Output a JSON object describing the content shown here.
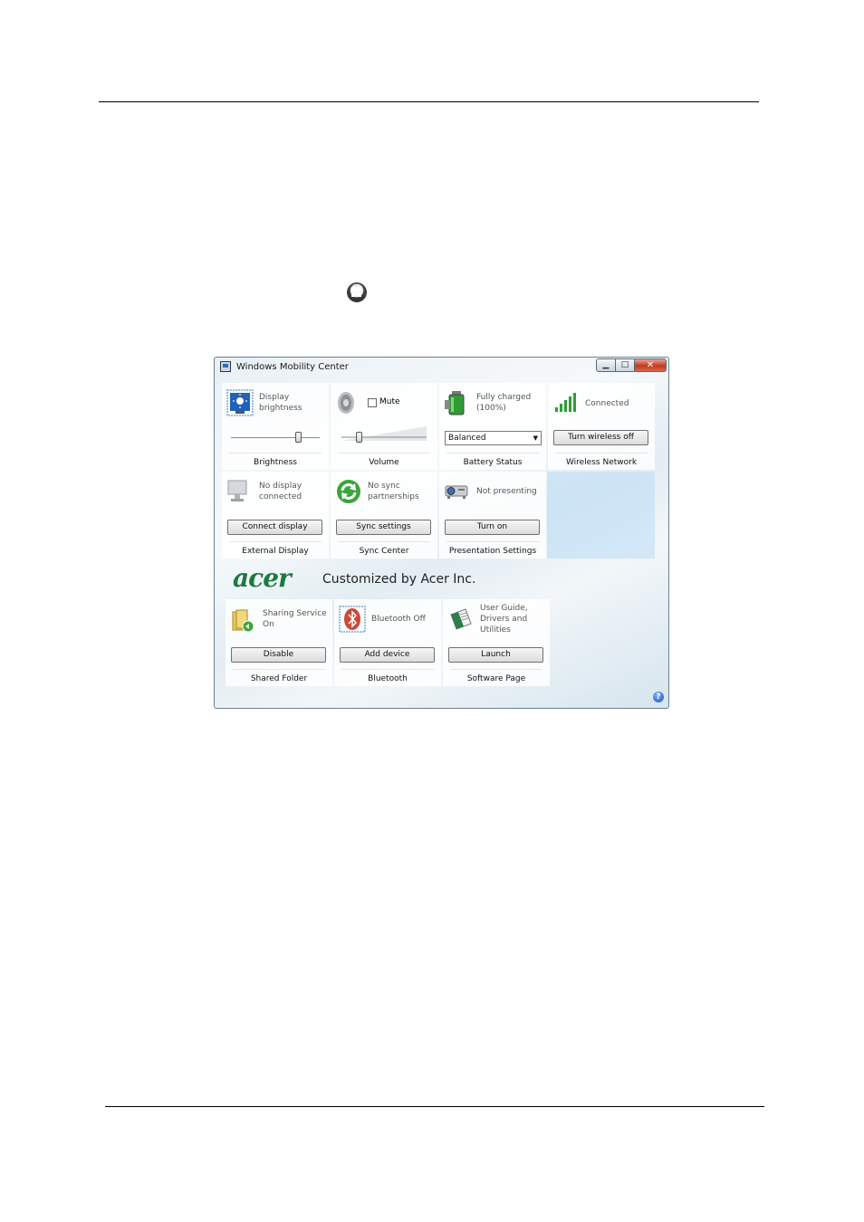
{
  "window": {
    "title": "Windows Mobility Center",
    "help_glyph": "?"
  },
  "tiles": {
    "brightness": {
      "text": "Display brightness",
      "label": "Brightness",
      "level": 0.75
    },
    "volume": {
      "mute_label": "Mute",
      "label": "Volume",
      "level": 0.2
    },
    "battery": {
      "text": "Fully charged (100%)",
      "plan": "Balanced",
      "label": "Battery Status"
    },
    "wireless": {
      "text": "Connected",
      "button": "Turn wireless off",
      "label": "Wireless Network"
    },
    "external_display": {
      "text": "No display connected",
      "button": "Connect display",
      "label": "External Display"
    },
    "sync": {
      "text": "No sync partnerships",
      "button": "Sync settings",
      "label": "Sync Center"
    },
    "presentation": {
      "text": "Not presenting",
      "button": "Turn on",
      "label": "Presentation Settings"
    }
  },
  "acer": {
    "logo": "acer",
    "tagline": "Customized by Acer Inc.",
    "tiles": {
      "shared_folder": {
        "text": "Sharing Service On",
        "button": "Disable",
        "label": "Shared Folder"
      },
      "bluetooth": {
        "text": "Bluetooth Off",
        "button": "Add device",
        "label": "Bluetooth"
      },
      "software": {
        "text": "User Guide, Drivers and Utilities",
        "button": "Launch",
        "label": "Software Page"
      }
    }
  },
  "colors": {
    "acer_green": "#1b7a3f",
    "highlight_blue": "#bedef7",
    "close_red": "#c33b22"
  }
}
